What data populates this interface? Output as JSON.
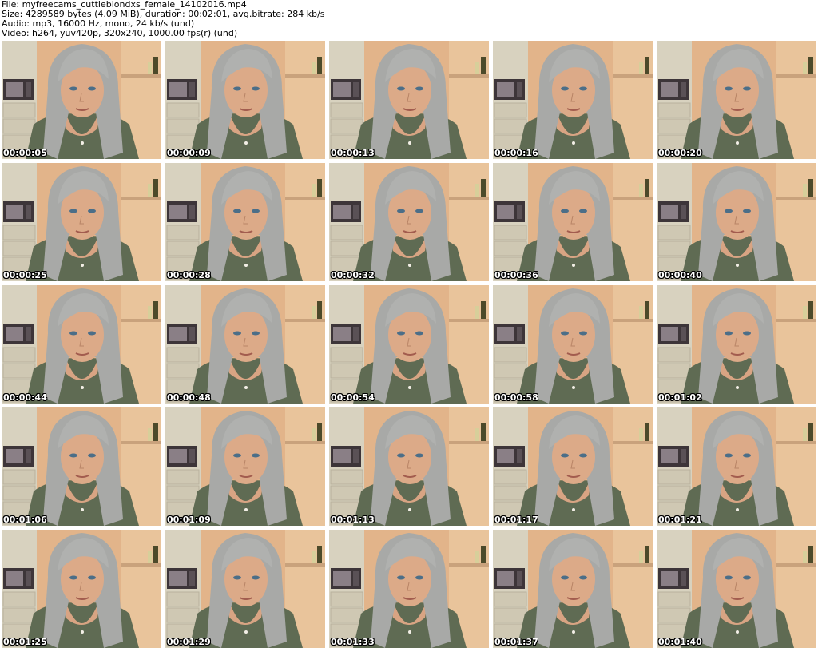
{
  "header": {
    "file": "File: myfreecams_cuttieblondxs_female_14102016.mp4",
    "size": "Size: 4289589 bytes (4.09 MiB), duration: 00:02:01, avg.bitrate: 284 kb/s",
    "audio": "Audio: mp3, 16000 Hz, mono, 24 kb/s (und)",
    "video": "Video: h264, yuv420p, 320x240, 1000.00 fps(r) (und)"
  },
  "thumbnails": [
    {
      "timestamp": "00:00:05"
    },
    {
      "timestamp": "00:00:09"
    },
    {
      "timestamp": "00:00:13"
    },
    {
      "timestamp": "00:00:16"
    },
    {
      "timestamp": "00:00:20"
    },
    {
      "timestamp": "00:00:25"
    },
    {
      "timestamp": "00:00:28"
    },
    {
      "timestamp": "00:00:32"
    },
    {
      "timestamp": "00:00:36"
    },
    {
      "timestamp": "00:00:40"
    },
    {
      "timestamp": "00:00:44"
    },
    {
      "timestamp": "00:00:48"
    },
    {
      "timestamp": "00:00:54"
    },
    {
      "timestamp": "00:00:58"
    },
    {
      "timestamp": "00:01:02"
    },
    {
      "timestamp": "00:01:06"
    },
    {
      "timestamp": "00:01:09"
    },
    {
      "timestamp": "00:01:13"
    },
    {
      "timestamp": "00:01:17"
    },
    {
      "timestamp": "00:01:21"
    },
    {
      "timestamp": "00:01:25"
    },
    {
      "timestamp": "00:01:29"
    },
    {
      "timestamp": "00:01:33"
    },
    {
      "timestamp": "00:01:37"
    },
    {
      "timestamp": "00:01:40"
    }
  ],
  "colors": {
    "background_wall": "#e6b98c",
    "cabinet": "#d9d4c2",
    "hair": "#a9aaa8",
    "skin": "#d9a987",
    "shirt": "#5e6a52",
    "microwave": "#3a3438"
  }
}
